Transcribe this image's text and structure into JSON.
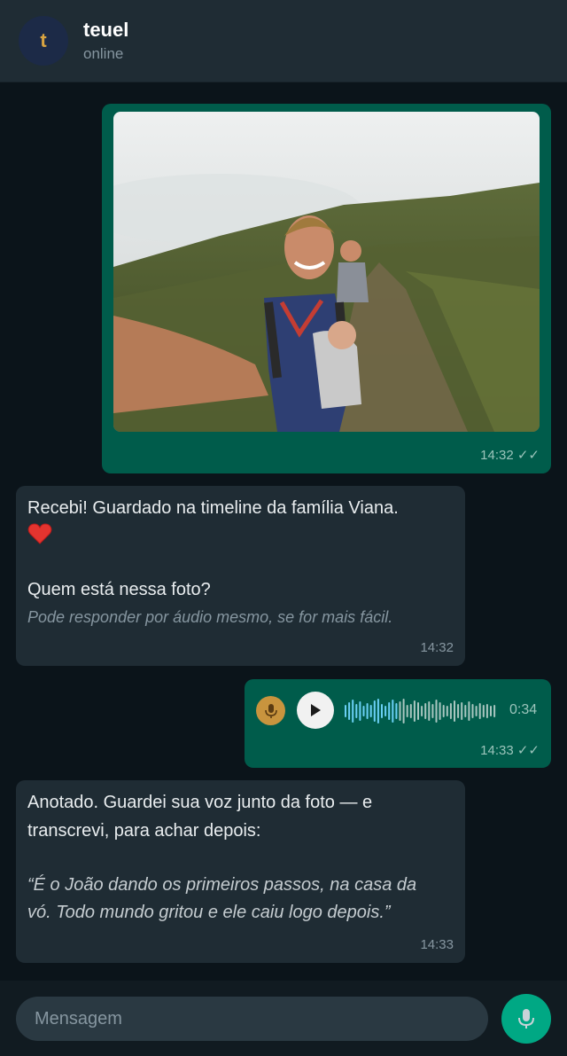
{
  "header": {
    "avatar_initial": "t",
    "name": "teuel",
    "status": "online"
  },
  "messages": {
    "photo": {
      "image": "selfie of a smiling hiker with a backpack and a woman on a misty grassy mountain trail",
      "time": "14:32",
      "ticks": "✓✓"
    },
    "reply1": {
      "line1": "Recebi! Guardado na timeline da família Viana.",
      "heart_icon": "red-heart",
      "line2": "Quem está nessa foto?",
      "hint": "Pode responder por áudio mesmo, se for mais fácil.",
      "time": "14:32"
    },
    "audio": {
      "duration": "0:34",
      "time": "14:33",
      "ticks": "✓✓"
    },
    "reply2": {
      "line1": "Anotado. Guardei sua voz junto da foto — e",
      "line2": "transcrevi, para achar depois:",
      "quote1": "“É o João dando os primeiros passos, na casa da",
      "quote2": "vó. Todo mundo gritou e ele caiu logo depois.”",
      "time": "14:33"
    }
  },
  "composer": {
    "placeholder": "Mensagem"
  },
  "colors": {
    "background": "#0b141a",
    "header": "#1f2c34",
    "outgoing_bubble": "#005c4b",
    "incoming_bubble": "#1f2c34",
    "accent_green": "#00a884",
    "mic_badge": "#c8943e"
  }
}
